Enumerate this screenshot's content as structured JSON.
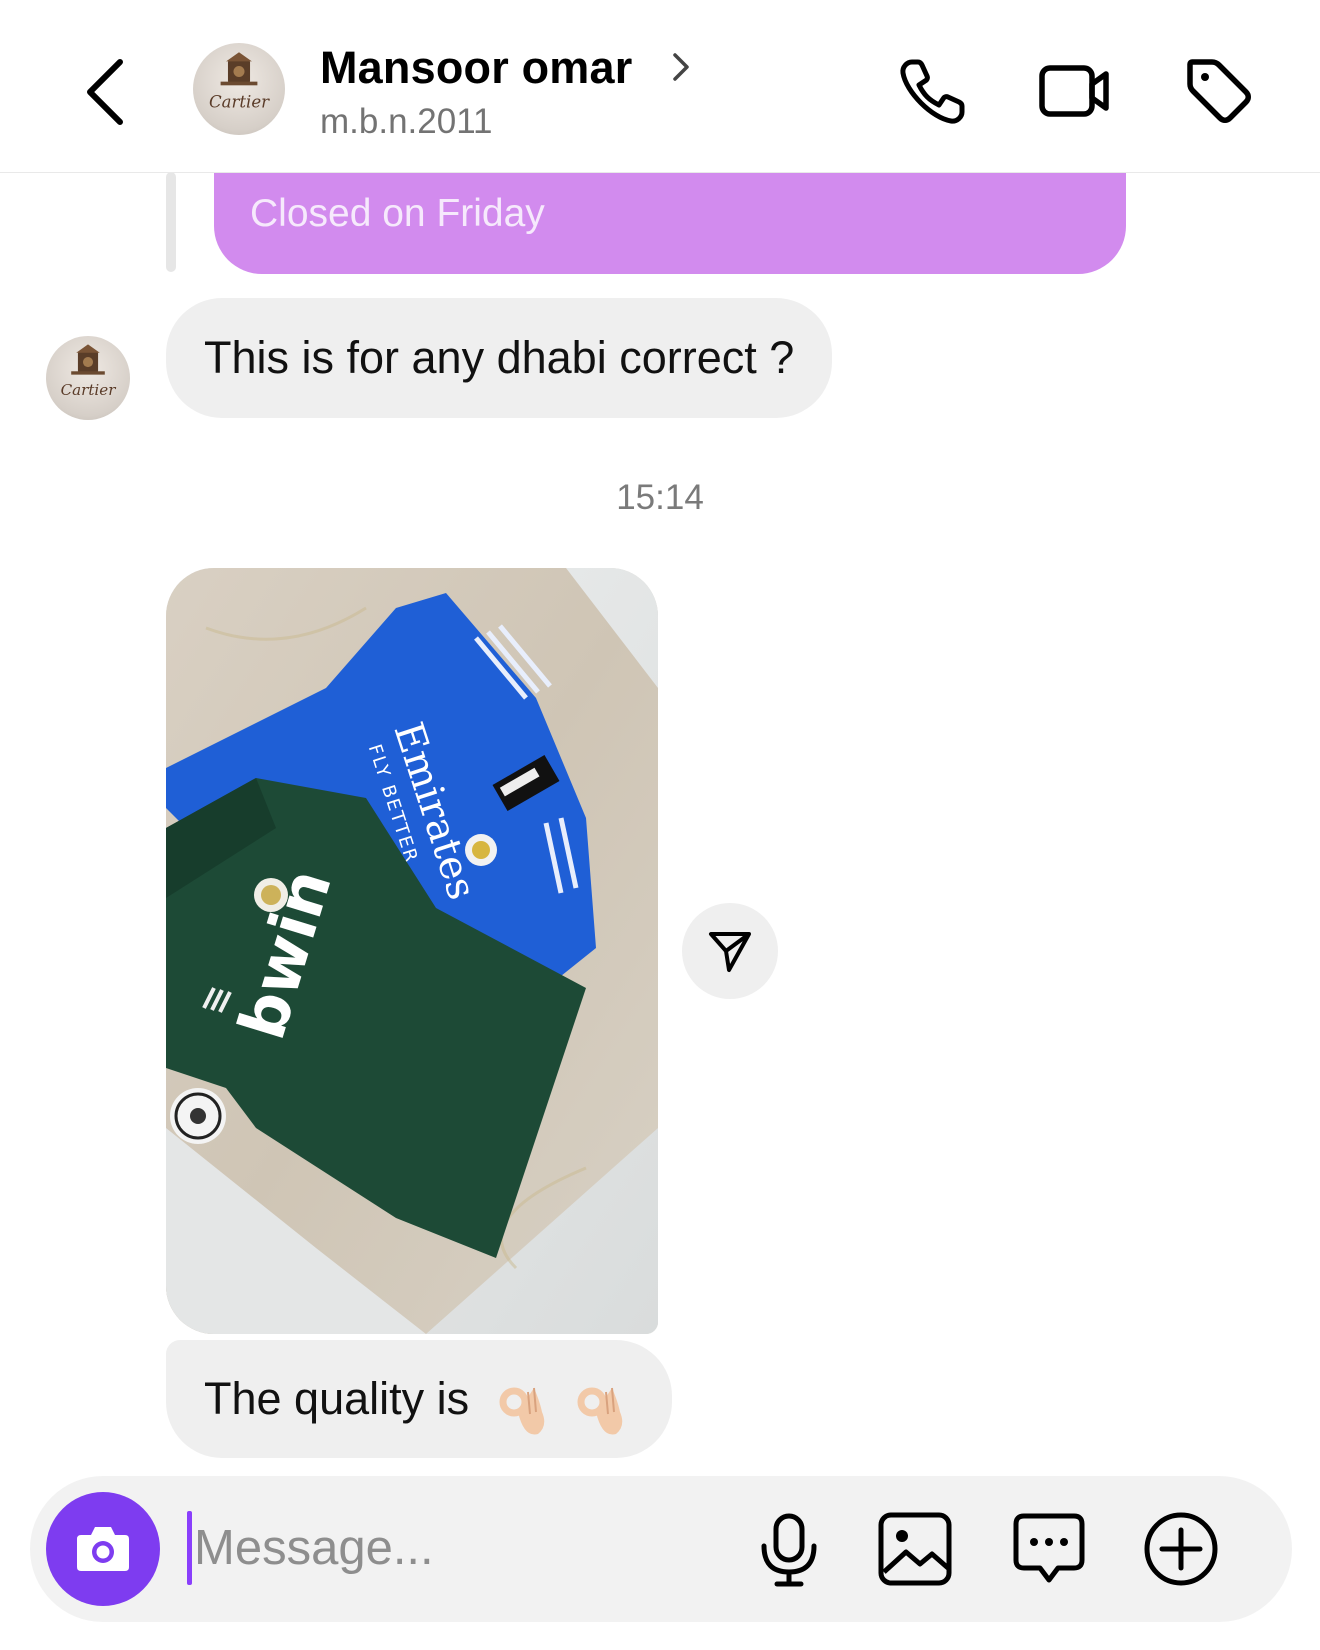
{
  "header": {
    "name": "Mansoor omar",
    "username": "m.b.n.2011",
    "avatar_text": "Cartier"
  },
  "thread": {
    "sent_message_tail": "Closed on Friday",
    "received_message_1": "This is for any dhabi correct ?",
    "timestamp": "15:14",
    "received_message_2": "The quality is"
  },
  "photo": {
    "jersey_blue_text_1": "Emirates",
    "jersey_blue_text_2": "FLY BETTER",
    "jersey_green_text": "bwin",
    "jersey_green_brand": "adidas"
  },
  "composer": {
    "placeholder": "Message..."
  },
  "icons": {
    "back": "chevron-left-icon",
    "profile": "chevron-right-icon",
    "call": "phone-icon",
    "video": "video-camera-icon",
    "tag": "tag-icon",
    "share": "send-icon",
    "camera": "camera-icon",
    "mic": "microphone-icon",
    "gallery": "image-icon",
    "sticker": "chat-bubble-icon",
    "plus": "plus-circle-icon",
    "emoji": "ok-hand-emoji"
  },
  "colors": {
    "sent_bubble": "#d28bee",
    "received_bubble": "#efefef",
    "camera_button": "#7e3cf0",
    "caret": "#8a3ffc"
  }
}
